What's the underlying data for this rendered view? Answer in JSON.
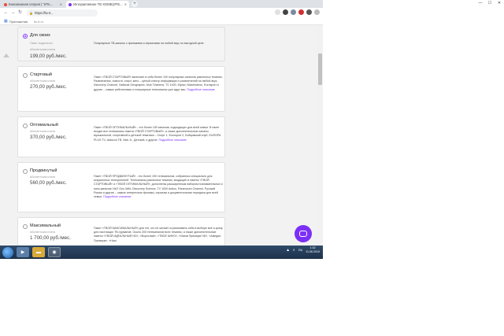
{
  "browser": {
    "tabs": [
      {
        "title": "Кинозванная опорня | \"ИТе...",
        "favicon_color": "#e74c3c",
        "active": false
      },
      {
        "title": "Интерактивное ТВ ХОМЕ(ИТЕ...",
        "favicon_color": "#7b2ff7",
        "active": true
      }
    ],
    "new_tab": "+",
    "window_controls": {
      "minimize": "—",
      "maximize": "☐",
      "close": "✕"
    },
    "url": "https://ltv.rt..."
  },
  "bookmarks": {
    "apps_label": "Приложения",
    "item": "ltv.rt.ru"
  },
  "plans": [
    {
      "name": "Для своих",
      "selected": true,
      "fee_label": "Пакет подключен",
      "fee_label2": "Абонентская плата",
      "price": "199,00 руб./мес.",
      "description": "Популярные ТВ-каналы с фильмами и сериалами на любой вкус по выгодной цене",
      "more": ""
    },
    {
      "name": "Стартовый",
      "selected": false,
      "fee_label": "Абонентская плата",
      "price": "270,00 руб./мес.",
      "description": "Пакет «ТВОЙ СТАРТОВЫЙ» включает в себя более 100 популярных каналов различных тематик. Развлечения, новости, спорт, кино – целый спектр информации и развлечений на любой вкус. Discovery Channel, National Geographic, Мое Планета, TV 1000, Мульт, Nickelodeon, Eurosport и другие – самые рейтинговые и популярные телеканалы уже ждут вас.",
      "more": "Подробное описание"
    },
    {
      "name": "Оптимальный",
      "selected": false,
      "fee_label": "Абонентская плата",
      "price": "370,00 руб./мес.",
      "description": "Пакет «ТВОЙ ОПТИМАЛЬНЫЙ» - это более 150 каналов, подходящих для всей семьи. В пакет входят все телеканалы пакета «ТВОЙ СТАРТОВЫЙ», а также дополнительные каналы музыкальной, спортивной и детской тематики – Спорт 1, Eurosport 2, Бойцовский клуб, EUROPA PLUS TV, Шансон ТВ, Nick Jr., Детский, и другие.",
      "more": "Подробное описание"
    },
    {
      "name": "Продвинутый",
      "selected": false,
      "fee_label": "Абонентская плата",
      "price": "560,00 руб./мес.",
      "description": "Пакет «ТВОЙ ПРОДВИНУТЫЙ» - это более 190 телеканалов, собранных специально для искушенных телезрителей. Телеканалы различных тематик, входящие в пакеты «ТВОЙ СТАРТОВЫЙ» и «ТВОЙ ОПТИМАЛЬНЫЙ», дополнены расширенным набором познавательных и кино-каналов: NAT Geo Wild, Discovery Science, TV 1000 Action, Paramount Channel, Русский Роман и другие – самые интересные фильмы, сериалы и документальные передачи для всей семьи.",
      "more": "Подробное описание"
    },
    {
      "name": "Максимальный",
      "selected": false,
      "fee_label": "Абонентская плата",
      "price": "1 700,00 руб./мес.",
      "description": "Пакет «ТВОЙ МАКСИМАЛЬНЫЙ» для тех, кто не желает ограничивать себя в выборе всё и сразу для настоящих ТВ-гурманов. Около 200 телеканалов всех тематик, а также дополнительные пакеты «ТВОЙ ИДЕАЛЬНЫЙ HD», «Взрослый», «ТВОЕ КИНО», «Viasat Премиум HD», «Амедиа Премиум», «Наш",
      "more": ""
    }
  ],
  "taskbar": {
    "time": "1:02",
    "date": "11.06.2019",
    "lang": "RU"
  }
}
